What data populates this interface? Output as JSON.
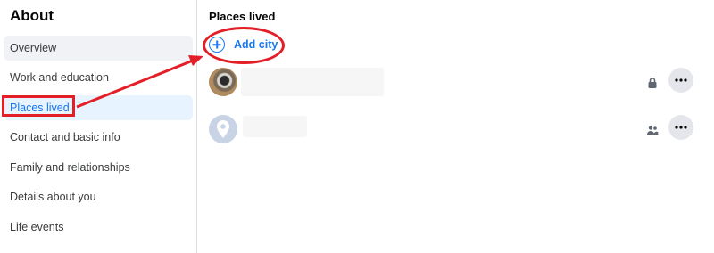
{
  "sidebar": {
    "title": "About",
    "items": [
      {
        "label": "Overview"
      },
      {
        "label": "Work and education"
      },
      {
        "label": "Places lived"
      },
      {
        "label": "Contact and basic info"
      },
      {
        "label": "Family and relationships"
      },
      {
        "label": "Details about you"
      },
      {
        "label": "Life events"
      }
    ]
  },
  "main": {
    "section_title": "Places lived",
    "add_city_label": "Add city",
    "entries": [
      {
        "privacy_icon": "lock-icon",
        "more_icon": "more-icon"
      },
      {
        "privacy_icon": "friends-icon",
        "more_icon": "more-icon"
      }
    ]
  },
  "colors": {
    "accent": "#1877f2",
    "annotation_red": "#e41e26",
    "active_bg": "#e7f3ff",
    "hover_bg": "#f0f2f5"
  }
}
